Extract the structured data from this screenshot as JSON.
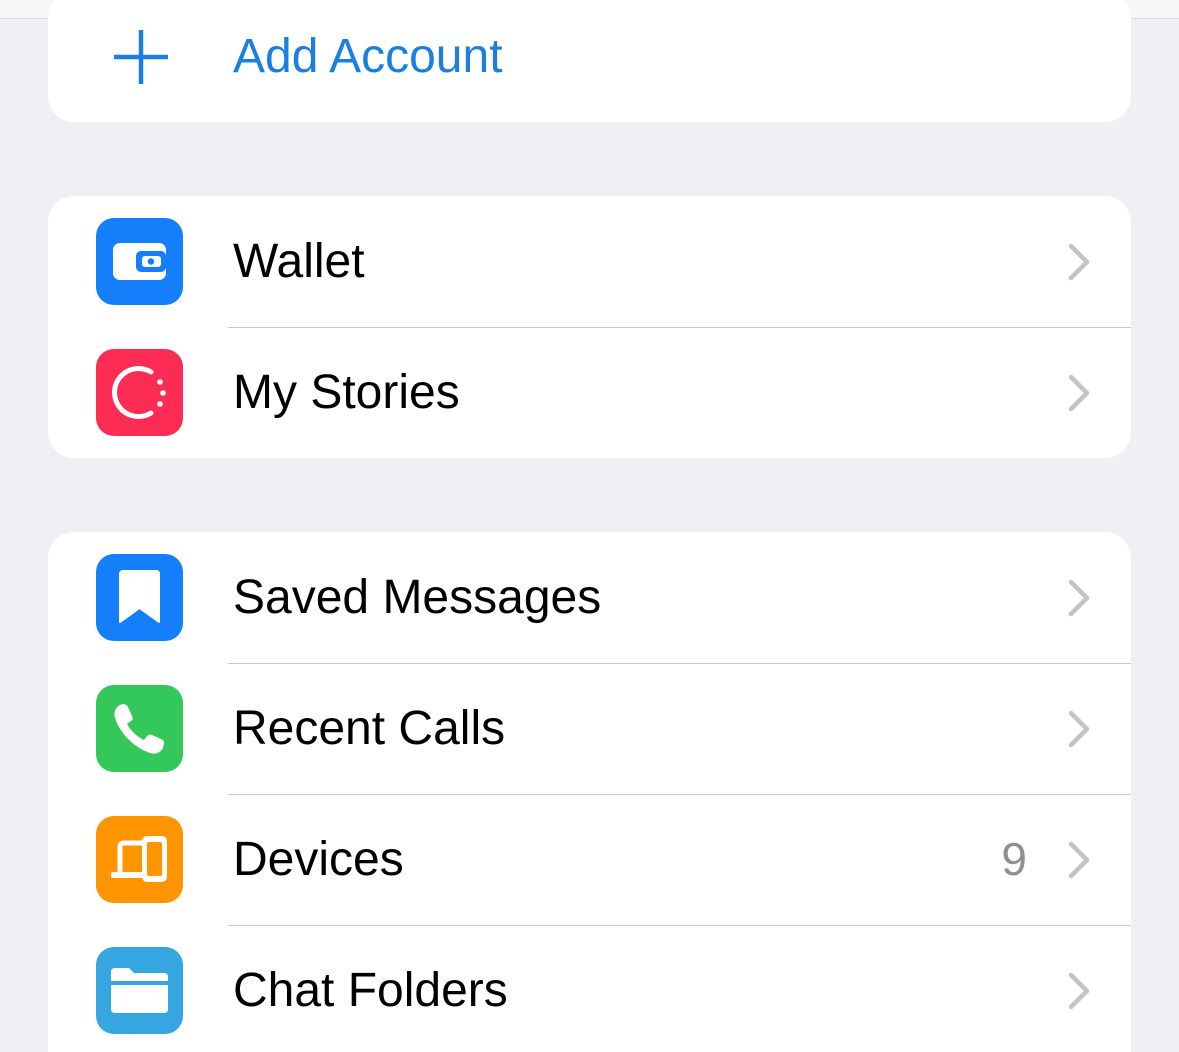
{
  "add_account": {
    "label": "Add Account",
    "icon": "plus-icon",
    "color": "#1a7fe0"
  },
  "group_wallet": [
    {
      "key": "wallet",
      "label": "Wallet",
      "icon": "wallet-icon",
      "color": "#147efb"
    },
    {
      "key": "my-stories",
      "label": "My Stories",
      "icon": "stories-icon",
      "color": "#fd2c55"
    }
  ],
  "group_main": [
    {
      "key": "saved-messages",
      "label": "Saved Messages",
      "icon": "bookmark-icon",
      "color": "#147efb"
    },
    {
      "key": "recent-calls",
      "label": "Recent Calls",
      "icon": "phone-icon",
      "color": "#34c759"
    },
    {
      "key": "devices",
      "label": "Devices",
      "value": "9",
      "icon": "devices-icon",
      "color": "#ff9500"
    },
    {
      "key": "chat-folders",
      "label": "Chat Folders",
      "icon": "folder-icon",
      "color": "#36a6e0"
    }
  ],
  "colors": {
    "background": "#efeff4",
    "chevron": "#c4c4c7",
    "value_text": "#8e8e93"
  }
}
